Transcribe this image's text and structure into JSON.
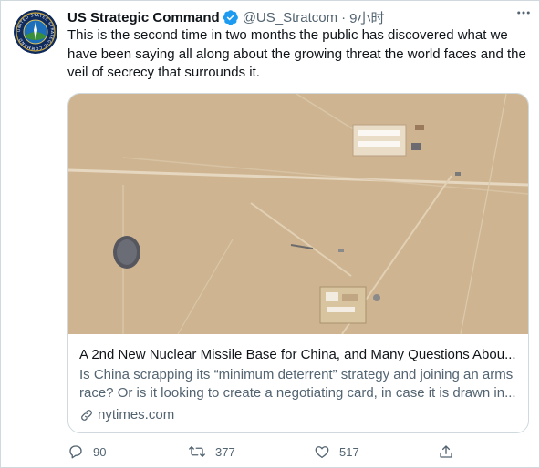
{
  "account": {
    "name": "US Strategic Command",
    "handle": "@US_Stratcom",
    "separator": "·",
    "time": "9小时",
    "avatar_ring_text": "UNITED STATES STRATEGIC COMMAND"
  },
  "tweet": {
    "text": "This is the second time in two months the public has discovered what we have been saying all along about the growing threat the world faces and the veil of secrecy that surrounds it."
  },
  "card": {
    "title": "A 2nd New Nuclear Missile Base for China, and Many Questions Abou...",
    "description": "Is China scrapping its “minimum deterrent” strategy and joining an arms race? Or is it looking to create a negotiating card, in case it is drawn in...",
    "domain": "nytimes.com"
  },
  "actions": {
    "replies": "90",
    "retweets": "377",
    "likes": "517"
  },
  "icons": [
    "verified-badge-icon",
    "more-options-icon",
    "link-icon",
    "reply-icon",
    "retweet-icon",
    "like-icon",
    "share-icon"
  ],
  "colors": {
    "verified": "#1d9bf0",
    "text": "#0f1419",
    "secondary": "#536471",
    "border": "#cfd9de",
    "desert": "#d2b895"
  }
}
